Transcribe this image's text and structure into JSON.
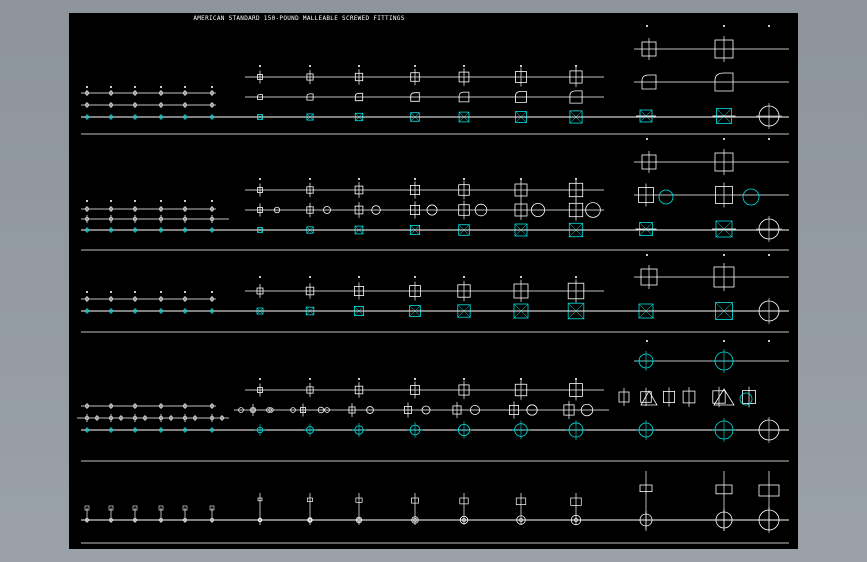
{
  "drawing": {
    "title": "AMERICAN STANDARD 150-POUND MALLEABLE SCREWED FITTINGS",
    "background": "#000000",
    "line_color": "#ffffff",
    "accent_color": "#00e5e5",
    "viewport_color": "#939aa2"
  }
}
